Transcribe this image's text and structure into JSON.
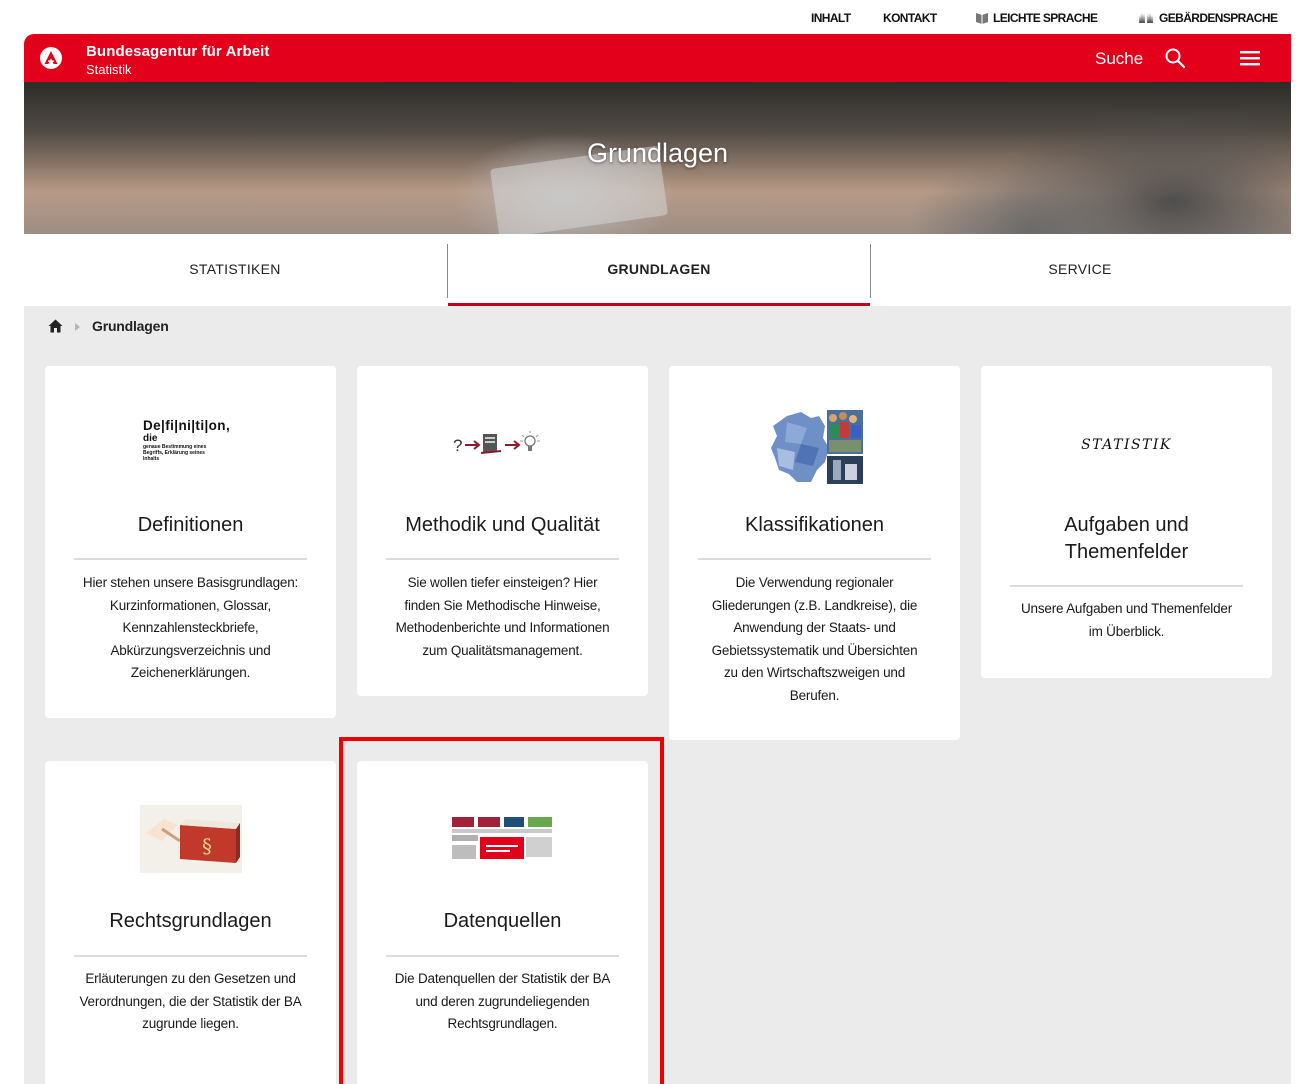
{
  "utility_links": [
    {
      "label": "INHALT"
    },
    {
      "label": "KONTAKT"
    },
    {
      "label": "LEICHTE SPRACHE",
      "icon": "book-icon"
    },
    {
      "label": "GEBÄRDENSPRACHE",
      "icon": "hands-icon"
    }
  ],
  "header": {
    "brand": "Bundesagentur für Arbeit",
    "brand_sub": "Statistik",
    "search_label": "Suche",
    "accent_color": "#e2001a"
  },
  "hero": {
    "title": "Grundlagen"
  },
  "tabs": [
    {
      "label": "STATISTIKEN",
      "active": false
    },
    {
      "label": "GRUNDLAGEN",
      "active": true
    },
    {
      "label": "SERVICE",
      "active": false
    }
  ],
  "breadcrumb": {
    "current": "Grundlagen"
  },
  "cards": [
    {
      "title": "Definitionen",
      "image": {
        "icon": "definition-icon",
        "word": "De|fi|ni|ti|on,",
        "sub": "die",
        "caption1": "genaue Bestimmung eines",
        "caption2": "Begriffs, Erklärung seines",
        "caption3": "Inhalts"
      },
      "desc_lines": [
        "Hier stehen unsere Basisgrundlagen:",
        "Kurzinformationen, Glossar,",
        "Kennzahlensteckbriefe,",
        "Abkürzungsverzeichnis und",
        "Zeichenerklärungen."
      ]
    },
    {
      "title": "Methodik und Qualität",
      "image": {
        "icon": "method-flow-icon"
      },
      "desc_lines": [
        "Sie wollen tiefer einsteigen? Hier",
        "finden Sie Methodische Hinweise,",
        "Methodenberichte und Informationen",
        "zum Qualitätsmanagement."
      ]
    },
    {
      "title": "Klassifikationen",
      "image": {
        "icon": "germany-map-icon"
      },
      "desc_lines": [
        "Die Verwendung regionaler",
        "Gliederungen (z.B. Landkreise), die",
        "Anwendung der Staats- und",
        "Gebietssystematik und Übersichten",
        "zu den Wirtschaftszweigen und",
        "Berufen."
      ]
    },
    {
      "title_lines": [
        "Aufgaben und",
        "Themenfelder"
      ],
      "image": {
        "icon": "statistik-logo",
        "text": "STATISTIK"
      },
      "desc_lines": [
        "Unsere Aufgaben und Themenfelder",
        "im Überblick."
      ]
    },
    {
      "title": "Rechtsgrundlagen",
      "image": {
        "icon": "law-book-icon"
      },
      "desc_lines": [
        "Erläuterungen zu den Gesetzen und",
        "Verordnungen, die der Statistik der BA",
        "zugrunde liegen."
      ]
    },
    {
      "title": "Datenquellen",
      "image": {
        "icon": "data-sources-diagram-icon"
      },
      "desc_lines": [
        "Die Datenquellen der Statistik der BA",
        "und deren zugrundeliegenden",
        "Rechtsgrundlagen."
      ]
    }
  ]
}
